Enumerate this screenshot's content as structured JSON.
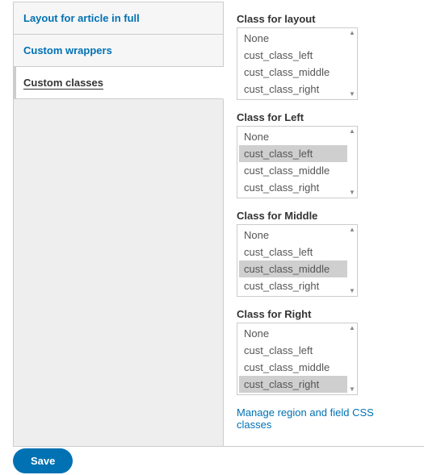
{
  "tabs": [
    {
      "label": "Layout for article in full",
      "active": false
    },
    {
      "label": "Custom wrappers",
      "active": false
    },
    {
      "label": "Custom classes",
      "active": true
    }
  ],
  "class_options": [
    "None",
    "cust_class_left",
    "cust_class_middle",
    "cust_class_right"
  ],
  "groups": [
    {
      "label": "Class for layout",
      "selected": []
    },
    {
      "label": "Class for Left",
      "selected": [
        "cust_class_left"
      ]
    },
    {
      "label": "Class for Middle",
      "selected": [
        "cust_class_middle"
      ]
    },
    {
      "label": "Class for Right",
      "selected": [
        "cust_class_right"
      ]
    }
  ],
  "manage_link": "Manage region and field CSS classes",
  "save_label": "Save"
}
